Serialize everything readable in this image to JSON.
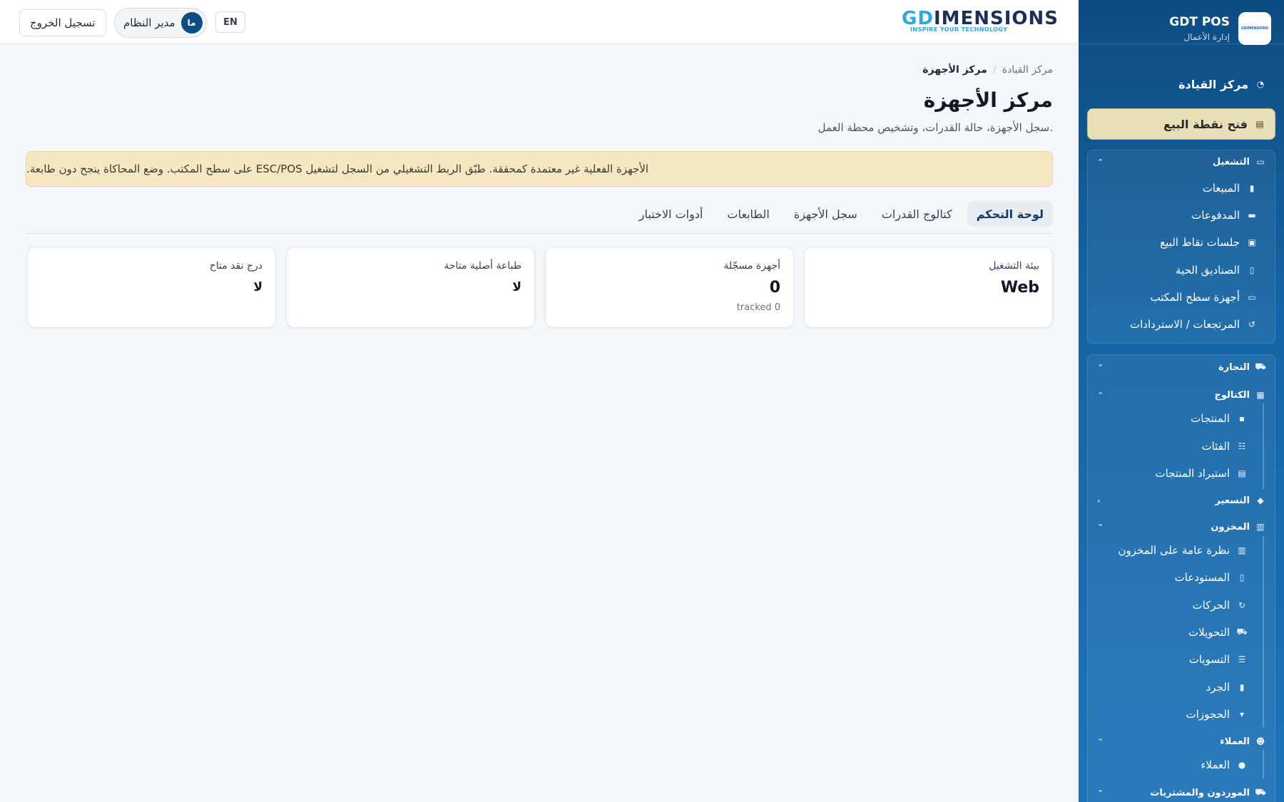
{
  "sidebar": {
    "brand_title": "GDT POS",
    "brand_subtitle": "إدارة الأعمال",
    "logo_text": "GDIMENSIONS",
    "dashboard_label": "مركز القيادة",
    "pos_label": "فتح نقطة البيع",
    "groups": {
      "operations": "التشغيل",
      "commerce": "التجارة",
      "catalog": "الكتالوج",
      "pricing": "التسعير",
      "inventory": "المخزون",
      "customers_group": "العملاء",
      "suppliers_group": "الموردون والمشتريات"
    },
    "operations_items": [
      "المبيعات",
      "المدفوعات",
      "جلسات نقاط البيع",
      "الصناديق الحية",
      "أجهزة سطح المكتب",
      "المرتجعات / الاستردادات"
    ],
    "catalog_items": [
      "المنتجات",
      "الفئات",
      "استيراد المنتجات"
    ],
    "inventory_items": [
      "نظرة عامة على المخزون",
      "المستودعات",
      "الحركات",
      "التحويلات",
      "التسويات",
      "الجرد",
      "الحجوزات"
    ],
    "customers_items": [
      "العملاء"
    ]
  },
  "topbar": {
    "logo_word_gd": "GD",
    "logo_word_rest": "IMENSIONS",
    "logo_tagline": "INSPIRE YOUR TECHNOLOGY",
    "logout_label": "تسجيل الخروج",
    "user_name": "مدير النظام",
    "user_initials": "ما",
    "lang_label": "EN"
  },
  "breadcrumb": {
    "root": "مركز القيادة",
    "separator": "/",
    "current": "مركز الأجهزة"
  },
  "page": {
    "title": "مركز الأجهزة",
    "subtitle": "سجل الأجهزة، حالة القدرات، وتشخيص محطة العمل.",
    "alert": "الأجهزة الفعلية غير معتمدة كمحققة. طبّق الربط التشغيلي من السجل لتشغيل ESC/POS على سطح المكتب. وضع المحاكاة ينجح دون طابعة."
  },
  "tabs": [
    "لوحة التحكم",
    "كتالوج القدرات",
    "سجل الأجهزة",
    "الطابعات",
    "أدوات الاختبار"
  ],
  "cards": [
    {
      "label": "بيئة التشغيل",
      "value": "Web",
      "note": ""
    },
    {
      "label": "أجهزة مسجّلة",
      "value": "0",
      "note": "tracked 0"
    },
    {
      "label": "طباعة أصلية متاحة",
      "value": "لا",
      "note": ""
    },
    {
      "label": "درج نقد متاح",
      "value": "لا",
      "note": ""
    }
  ],
  "colors": {
    "sidebar": "#0d4c82",
    "accent": "#27a9e1",
    "alert_bg": "#f4e7c2",
    "pos_btn": "#e9dfb6"
  },
  "icons": {
    "dashboard": "gauge-icon",
    "pos": "register-icon",
    "operations": "drawer-icon",
    "sales": "receipt-icon",
    "payments": "card-icon",
    "sessions": "cash-icon",
    "tills": "tablet-icon",
    "desktop": "monitor-icon",
    "returns": "undo-icon",
    "commerce": "cart-icon",
    "catalog": "boxes-icon",
    "pricing": "tags-icon",
    "inventory": "warehouse-icon",
    "customers": "users-icon",
    "suppliers": "truck-icon"
  }
}
